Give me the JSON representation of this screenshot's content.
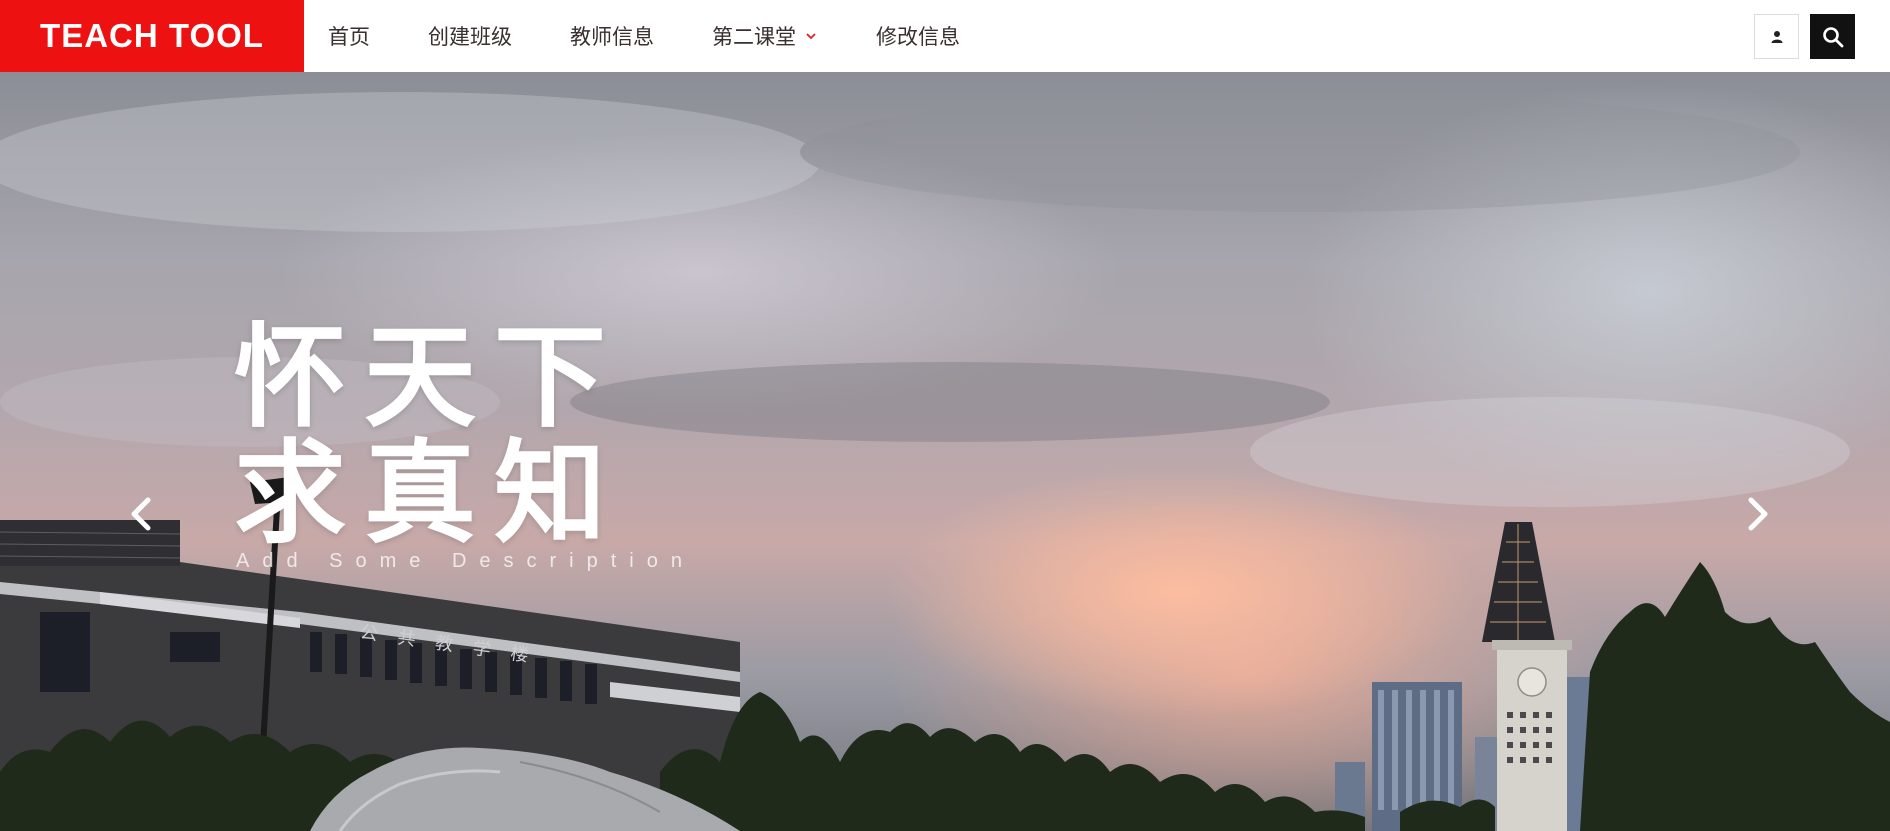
{
  "brand": {
    "name": "TEACH TOOL",
    "color": "#ee1111"
  },
  "nav": {
    "items": [
      {
        "label": "首页"
      },
      {
        "label": "创建班级"
      },
      {
        "label": "教师信息"
      },
      {
        "label": "第二课堂",
        "has_dropdown": true
      },
      {
        "label": "修改信息"
      }
    ],
    "actions": [
      {
        "icon": "user-icon"
      },
      {
        "icon": "search-icon"
      }
    ]
  },
  "hero": {
    "slogan_line1": "怀天下",
    "slogan_line2": "求真知",
    "subtitle": "Add Some Description",
    "building_sign": "公共教学楼",
    "prev_icon": "chevron-left-icon",
    "next_icon": "chevron-right-icon"
  }
}
